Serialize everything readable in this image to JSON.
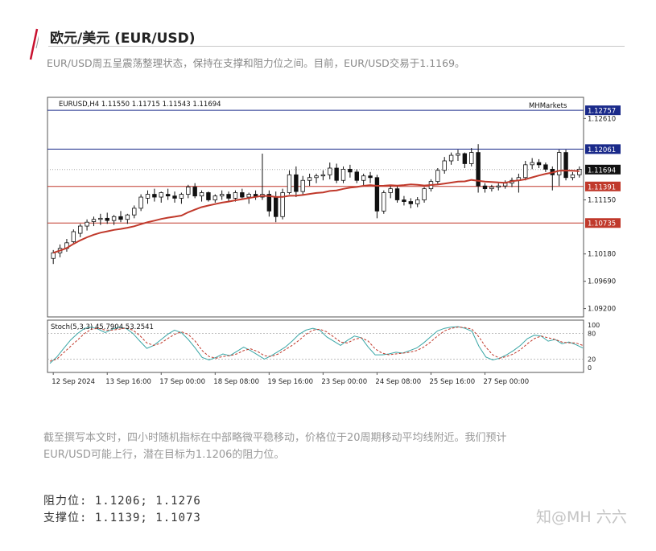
{
  "page": {
    "title": "欧元/美元 (EUR/USD)",
    "subtitle": "EUR/USD周五呈震荡整理状态，保持在支撑和阻力位之间。目前，EUR/USD交易于1.1169。",
    "paragraph_line1": "截至撰写本文时，四小时随机指标在中部略微平稳移动，价格位于20周期移动平均线附近。我们预计",
    "paragraph_line2": "EUR/USD可能上行，潜在目标为1.1206的阻力位。",
    "resistance_line": "阻力位: 1.1206; 1.1276",
    "support_line": "支撑位: 1.1139; 1.1073",
    "watermark": "知@MH 六六",
    "accent_color": "#c8102e"
  },
  "chart_data": {
    "type": "candlestick",
    "symbol_info": "EURUSD,H4  1.11550 1.11715 1.11543 1.11694",
    "brand": "MHMarkets",
    "price_ylim": [
      1.0905,
      1.1299
    ],
    "price_ticks": [
      "1.12610",
      "1.11150",
      "1.10180",
      "1.09690",
      "1.09200"
    ],
    "price_tick_values": [
      1.1261,
      1.1115,
      1.1018,
      1.0969,
      1.092
    ],
    "levels": [
      {
        "label": "1.12757",
        "value": 1.12757,
        "color": "#1a2a8a"
      },
      {
        "label": "1.12061",
        "value": 1.12061,
        "color": "#1a2a8a"
      },
      {
        "label": "1.11391",
        "value": 1.11391,
        "color": "#c0392b"
      },
      {
        "label": "1.10735",
        "value": 1.10735,
        "color": "#c0392b"
      }
    ],
    "current_price": {
      "label": "1.11694",
      "value": 1.11694
    },
    "candles": [
      [
        1.101,
        1.1025,
        1.1,
        1.102
      ],
      [
        1.102,
        1.1035,
        1.1012,
        1.1028
      ],
      [
        1.1028,
        1.1045,
        1.1022,
        1.1038
      ],
      [
        1.104,
        1.1062,
        1.1035,
        1.1058
      ],
      [
        1.1055,
        1.1072,
        1.1048,
        1.1068
      ],
      [
        1.1068,
        1.108,
        1.106,
        1.1075
      ],
      [
        1.1076,
        1.1085,
        1.1068,
        1.108
      ],
      [
        1.108,
        1.109,
        1.107,
        1.1082
      ],
      [
        1.1082,
        1.1092,
        1.1072,
        1.1078
      ],
      [
        1.1078,
        1.1088,
        1.107,
        1.1085
      ],
      [
        1.1085,
        1.1095,
        1.1075,
        1.108
      ],
      [
        1.108,
        1.109,
        1.1072,
        1.1088
      ],
      [
        1.1088,
        1.1105,
        1.1082,
        1.11
      ],
      [
        1.11,
        1.1125,
        1.1095,
        1.112
      ],
      [
        1.1118,
        1.1132,
        1.1108,
        1.1125
      ],
      [
        1.1125,
        1.1135,
        1.1112,
        1.112
      ],
      [
        1.112,
        1.113,
        1.111,
        1.1128
      ],
      [
        1.1125,
        1.1135,
        1.1115,
        1.1122
      ],
      [
        1.1122,
        1.113,
        1.111,
        1.1118
      ],
      [
        1.1118,
        1.1128,
        1.1108,
        1.1125
      ],
      [
        1.1125,
        1.1142,
        1.1118,
        1.1138
      ],
      [
        1.1138,
        1.1145,
        1.1118,
        1.1122
      ],
      [
        1.1122,
        1.1132,
        1.1112,
        1.1128
      ],
      [
        1.1128,
        1.113,
        1.1112,
        1.1115
      ],
      [
        1.1115,
        1.1125,
        1.111,
        1.1122
      ],
      [
        1.1122,
        1.1132,
        1.1115,
        1.1125
      ],
      [
        1.1125,
        1.113,
        1.1112,
        1.1118
      ],
      [
        1.1118,
        1.1132,
        1.1112,
        1.1128
      ],
      [
        1.1128,
        1.1135,
        1.1118,
        1.112
      ],
      [
        1.112,
        1.1128,
        1.1108,
        1.1125
      ],
      [
        1.1125,
        1.1132,
        1.1115,
        1.112
      ],
      [
        1.112,
        1.1198,
        1.1115,
        1.1125
      ],
      [
        1.1125,
        1.1132,
        1.1085,
        1.1095
      ],
      [
        1.112,
        1.113,
        1.1075,
        1.1085
      ],
      [
        1.1085,
        1.1135,
        1.108,
        1.1128
      ],
      [
        1.1128,
        1.1168,
        1.1125,
        1.116
      ],
      [
        1.116,
        1.1175,
        1.112,
        1.113
      ],
      [
        1.113,
        1.1158,
        1.1125,
        1.115
      ],
      [
        1.115,
        1.1162,
        1.114,
        1.1155
      ],
      [
        1.1155,
        1.1162,
        1.1145,
        1.1158
      ],
      [
        1.1158,
        1.1168,
        1.115,
        1.116
      ],
      [
        1.116,
        1.1182,
        1.1152,
        1.1172
      ],
      [
        1.1172,
        1.118,
        1.1145,
        1.115
      ],
      [
        1.115,
        1.1175,
        1.1145,
        1.117
      ],
      [
        1.117,
        1.1178,
        1.1155,
        1.1165
      ],
      [
        1.1165,
        1.117,
        1.1145,
        1.115
      ],
      [
        1.115,
        1.1162,
        1.114,
        1.1158
      ],
      [
        1.1158,
        1.1165,
        1.1145,
        1.1155
      ],
      [
        1.1155,
        1.116,
        1.1082,
        1.1095
      ],
      [
        1.1095,
        1.1132,
        1.109,
        1.1128
      ],
      [
        1.1128,
        1.114,
        1.1118,
        1.1135
      ],
      [
        1.1135,
        1.114,
        1.111,
        1.1115
      ],
      [
        1.1115,
        1.1122,
        1.1105,
        1.1112
      ],
      [
        1.1112,
        1.1118,
        1.11,
        1.1108
      ],
      [
        1.1108,
        1.112,
        1.1102,
        1.1115
      ],
      [
        1.1115,
        1.1138,
        1.111,
        1.1135
      ],
      [
        1.1135,
        1.1152,
        1.113,
        1.1148
      ],
      [
        1.1148,
        1.1172,
        1.1142,
        1.1168
      ],
      [
        1.1168,
        1.1192,
        1.1162,
        1.1185
      ],
      [
        1.1185,
        1.12,
        1.1178,
        1.1195
      ],
      [
        1.1195,
        1.1205,
        1.1185,
        1.1198
      ],
      [
        1.1198,
        1.12,
        1.1172,
        1.118
      ],
      [
        1.118,
        1.1208,
        1.1175,
        1.12
      ],
      [
        1.12,
        1.1215,
        1.1128,
        1.114
      ],
      [
        1.114,
        1.1145,
        1.1128,
        1.1135
      ],
      [
        1.1135,
        1.1142,
        1.113,
        1.1138
      ],
      [
        1.1138,
        1.1145,
        1.1132,
        1.114
      ],
      [
        1.114,
        1.115,
        1.1135,
        1.1145
      ],
      [
        1.1145,
        1.1155,
        1.1138,
        1.115
      ],
      [
        1.115,
        1.1162,
        1.1128,
        1.1155
      ],
      [
        1.1155,
        1.1185,
        1.115,
        1.1178
      ],
      [
        1.1178,
        1.119,
        1.117,
        1.1182
      ],
      [
        1.1182,
        1.1188,
        1.1172,
        1.1178
      ],
      [
        1.1178,
        1.1182,
        1.1165,
        1.117
      ],
      [
        1.117,
        1.1175,
        1.1132,
        1.116
      ],
      [
        1.116,
        1.1205,
        1.114,
        1.12
      ],
      [
        1.12,
        1.1205,
        1.115,
        1.1155
      ],
      [
        1.1155,
        1.1165,
        1.115,
        1.116
      ],
      [
        1.116,
        1.1175,
        1.1155,
        1.117
      ]
    ],
    "ma_period": 20,
    "stoch": {
      "label": "Stoch(5,3,3) 45.7904 53.2541",
      "ylim": [
        0,
        100
      ],
      "ticks": [
        "100",
        "80",
        "20",
        "0"
      ],
      "tick_values": [
        100,
        80,
        20,
        0
      ],
      "main": [
        10,
        25,
        45,
        65,
        80,
        92,
        95,
        90,
        82,
        90,
        95,
        92,
        80,
        62,
        45,
        52,
        65,
        78,
        88,
        82,
        66,
        46,
        24,
        18,
        24,
        32,
        28,
        38,
        48,
        40,
        30,
        20,
        28,
        38,
        48,
        62,
        78,
        88,
        92,
        88,
        72,
        62,
        52,
        64,
        74,
        70,
        48,
        30,
        30,
        32,
        36,
        34,
        40,
        46,
        58,
        72,
        86,
        92,
        95,
        96,
        92,
        85,
        50,
        25,
        18,
        22,
        30,
        40,
        52,
        68,
        76,
        74,
        62,
        66,
        56,
        60,
        54,
        46
      ],
      "signal": [
        15,
        20,
        35,
        50,
        65,
        80,
        90,
        92,
        88,
        88,
        90,
        93,
        88,
        75,
        58,
        52,
        57,
        68,
        78,
        84,
        78,
        62,
        40,
        26,
        22,
        26,
        28,
        32,
        40,
        44,
        38,
        28,
        26,
        32,
        42,
        52,
        64,
        78,
        88,
        90,
        84,
        72,
        60,
        58,
        66,
        70,
        62,
        44,
        34,
        30,
        32,
        34,
        36,
        40,
        48,
        60,
        74,
        86,
        92,
        95,
        94,
        90,
        72,
        48,
        30,
        22,
        26,
        32,
        42,
        56,
        68,
        74,
        70,
        66,
        60,
        58,
        58,
        52
      ]
    },
    "x_tick_labels": [
      "12 Sep 2024",
      "13 Sep 16:00",
      "17 Sep 00:00",
      "18 Sep 08:00",
      "19 Sep 16:00",
      "23 Sep 00:00",
      "24 Sep 08:00",
      "25 Sep 16:00",
      "27 Sep 00:00"
    ],
    "x_tick_index": [
      0,
      8,
      16,
      24,
      32,
      40,
      48,
      56,
      64
    ]
  }
}
